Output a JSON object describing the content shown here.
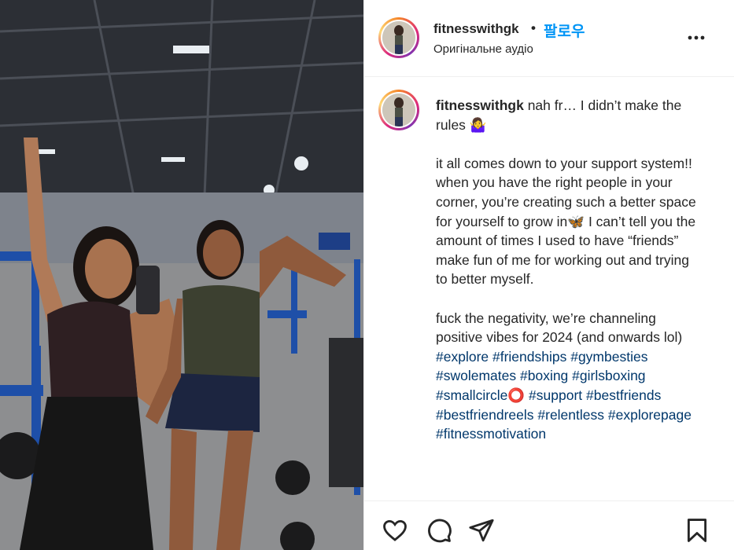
{
  "post": {
    "username": "fitnesswithgk",
    "separator": "•",
    "follow_label": "팔로우",
    "audio_label": "Оригінальне аудіо"
  },
  "caption": {
    "username": "fitnesswithgk",
    "text": " nah fr… I didn’t make the rules 🤷‍♀️\n\nit all comes down to your support system!! when you have the right people in your corner, you’re creating such a better space for yourself to grow in🦋 I can’t tell you the amount of times I used to have “friends” make fun of me for working out and trying to better myself.\n\nfuck the negativity, we’re channeling positive vibes for 2024 (and onwards lol)\n",
    "hashtags": "#explore #friendships #gymbesties #swolemates #boxing #girlsboxing #smallcircle⭕ #support #bestfriends #bestfriendreels #relentless #explorepage #fitnessmotivation"
  },
  "icons": {
    "more": "more-options-icon",
    "like": "heart-icon",
    "comment": "comment-icon",
    "share": "share-icon",
    "save": "bookmark-icon"
  },
  "colors": {
    "follow_blue": "#0095f6",
    "hashtag_blue": "#00376b",
    "text": "#262626"
  }
}
